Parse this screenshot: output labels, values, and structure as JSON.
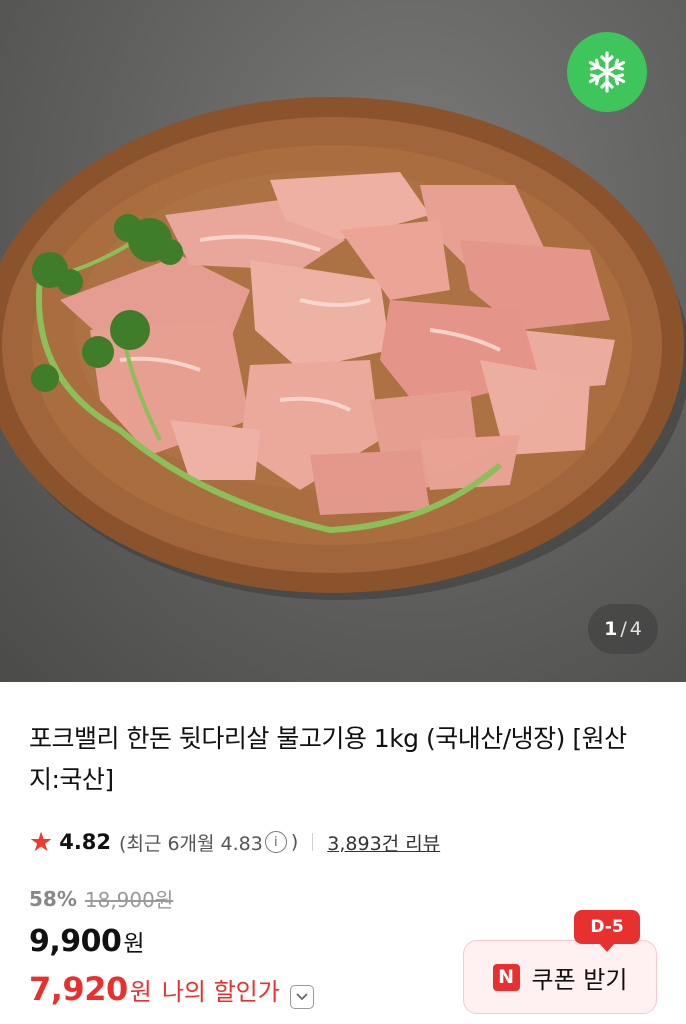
{
  "product": {
    "title": "포크밸리 한돈 뒷다리살 불고기용 1kg (국내산/냉장) [원산지:국산]",
    "image_alt": "product-photo-pork-slices",
    "badge_icon": "snowflake-icon"
  },
  "gallery": {
    "current": "1",
    "separator": "/",
    "total": "4"
  },
  "rating": {
    "score": "4.82",
    "recent_prefix": "(최근 6개월 4.83",
    "recent_suffix": ")",
    "info_glyph": "i",
    "reviews": "3,893건 리뷰"
  },
  "price": {
    "discount_rate": "58%",
    "original": "18,900원",
    "sale_number": "9,900",
    "sale_unit": "원",
    "my_number": "7,920",
    "my_unit": "원",
    "my_label": "나의 할인가"
  },
  "coupon": {
    "logo": "N",
    "label": "쿠폰 받기",
    "dday": "D-5"
  },
  "colors": {
    "accent_red": "#e8312f",
    "frozen_green": "#3ec65c",
    "star": "#ef3b2d"
  }
}
